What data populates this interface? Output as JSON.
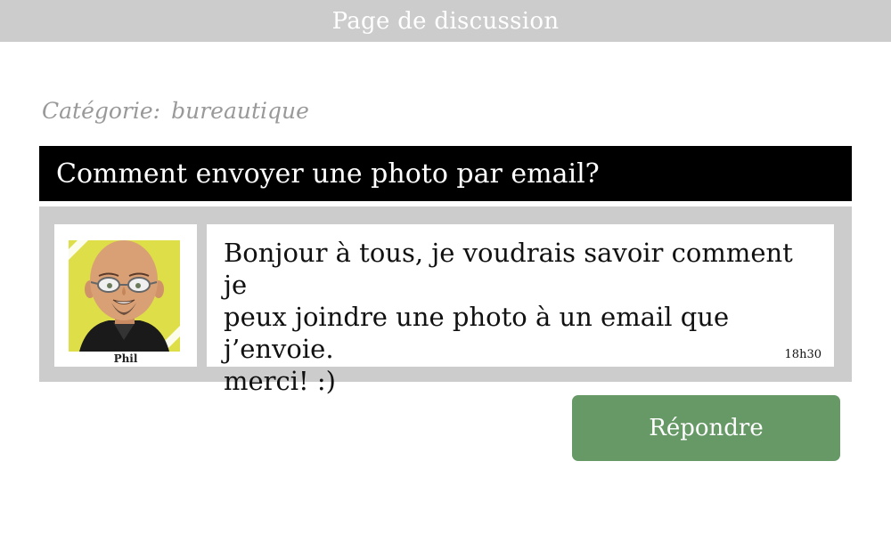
{
  "header": {
    "title": "Page de discussion"
  },
  "category": {
    "label": "Catégorie:",
    "value": "bureautique"
  },
  "topic": {
    "title": "Comment envoyer une photo par email?"
  },
  "post": {
    "author": "Phil",
    "message": "Bonjour à tous, je voudrais savoir comment je\npeux joindre une photo à un email que j’envoie.\nmerci! :)",
    "time": "18h30"
  },
  "actions": {
    "reply_label": "Répondre"
  },
  "colors": {
    "header_bg": "#cccccc",
    "title_bar_bg": "#000000",
    "post_bg": "#cccccc",
    "reply_button_bg": "#669966",
    "avatar_bg": "#dede48"
  }
}
